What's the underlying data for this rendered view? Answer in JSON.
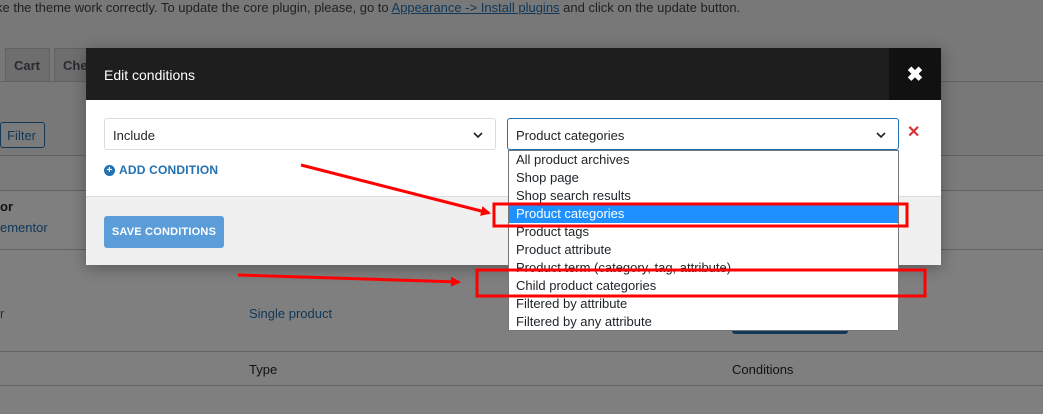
{
  "notice": {
    "prefix": "ke the theme work correctly. To update the core plugin, please, go to ",
    "link": "Appearance -> Install plugins",
    "suffix": " and click on the update button."
  },
  "tabs": [
    {
      "label": "Cart"
    },
    {
      "label": "Che"
    }
  ],
  "filter_label": "Filter",
  "table": {
    "row1": {
      "title_frag": "or",
      "sub_frag": "ementor"
    },
    "row2": {
      "title_frag": "r",
      "type": "Single product"
    },
    "footer": {
      "type": "Type",
      "conditions": "Conditions"
    }
  },
  "modal": {
    "title": "Edit conditions",
    "close_glyph": "✖",
    "include_value": "Include",
    "condition_value": "Product categories",
    "remove_glyph": "✕",
    "add_condition": "ADD CONDITION",
    "save_label": "SAVE CONDITIONS"
  },
  "dropdown": {
    "options": [
      "All product archives",
      "Shop page",
      "Shop search results",
      "Product categories",
      "Product tags",
      "Product attribute",
      "Product term (category, tag, attribute)",
      "Child product categories",
      "Filtered by attribute",
      "Filtered by any attribute"
    ],
    "selected": "Product categories"
  },
  "colors": {
    "accent": "#2271b1",
    "highlight": "#1e90ff",
    "annotation": "#ff0000"
  }
}
